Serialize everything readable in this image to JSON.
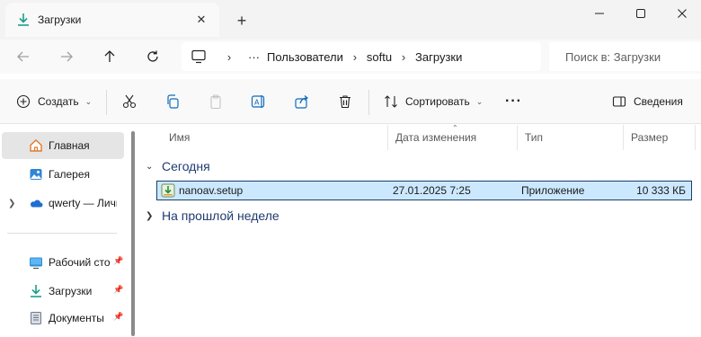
{
  "window": {
    "tab_title": "Загрузки",
    "close_tab_glyph": "✕",
    "new_tab_glyph": "+"
  },
  "address": {
    "ellipsis": "···",
    "breadcrumbs": [
      "Пользователи",
      "softu",
      "Загрузки"
    ],
    "separator": "›",
    "search_placeholder": "Поиск в: Загрузки"
  },
  "toolbar": {
    "create_label": "Создать",
    "sort_label": "Сортировать",
    "more_glyph": "···",
    "details_label": "Сведения"
  },
  "sidebar": {
    "items": [
      {
        "label": "Главная",
        "icon": "home-icon",
        "active": true
      },
      {
        "label": "Галерея",
        "icon": "gallery-icon"
      },
      {
        "label": "qwerty — Личн",
        "icon": "onedrive-icon"
      },
      {
        "label": "Рабочий сто",
        "icon": "desktop-icon",
        "pinned": true
      },
      {
        "label": "Загрузки",
        "icon": "download-icon",
        "pinned": true
      },
      {
        "label": "Документы",
        "icon": "documents-icon",
        "pinned": true
      }
    ]
  },
  "filelist": {
    "columns": [
      "Имя",
      "Дата изменения",
      "Тип",
      "Размер"
    ],
    "groups": [
      "Сегодня",
      "На прошлой неделе"
    ],
    "files": [
      {
        "name": "nanoav.setup",
        "date": "27.01.2025 7:25",
        "type": "Приложение",
        "size": "10 333 КБ",
        "icon": "installer-icon"
      }
    ]
  },
  "colors": {
    "selection_bg": "#cce8ff",
    "selection_border": "#1c3e6e",
    "accent": "#0078d4",
    "group_text": "#1f3b70"
  }
}
